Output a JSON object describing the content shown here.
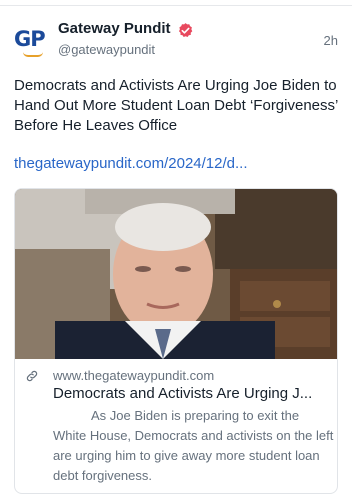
{
  "post": {
    "author_name": "Gateway Pundit",
    "author_handle": "@gatewaypundit",
    "avatar_text": "GP",
    "timestamp": "2h",
    "text": "Democrats and Activists Are Urging Joe Biden to Hand Out More Student Loan Debt ‘Forgiveness’ Before He Leaves Office",
    "link_text": "thegatewaypundit.com/2024/12/d..."
  },
  "card": {
    "domain": "www.thegatewaypundit.com",
    "title": "Democrats and Activists Are Urging J...",
    "description": "As Joe Biden is preparing to exit the White House, Democrats and activists on the left are urging him to give away more student loan debt forgiveness."
  },
  "icons": {
    "verified": "verified-badge-icon",
    "link": "link-icon"
  },
  "colors": {
    "link": "#2a67c8",
    "verified_badge": "#e8495e",
    "brand_blue": "#1b4a9a",
    "brand_orange": "#e7a12a"
  }
}
